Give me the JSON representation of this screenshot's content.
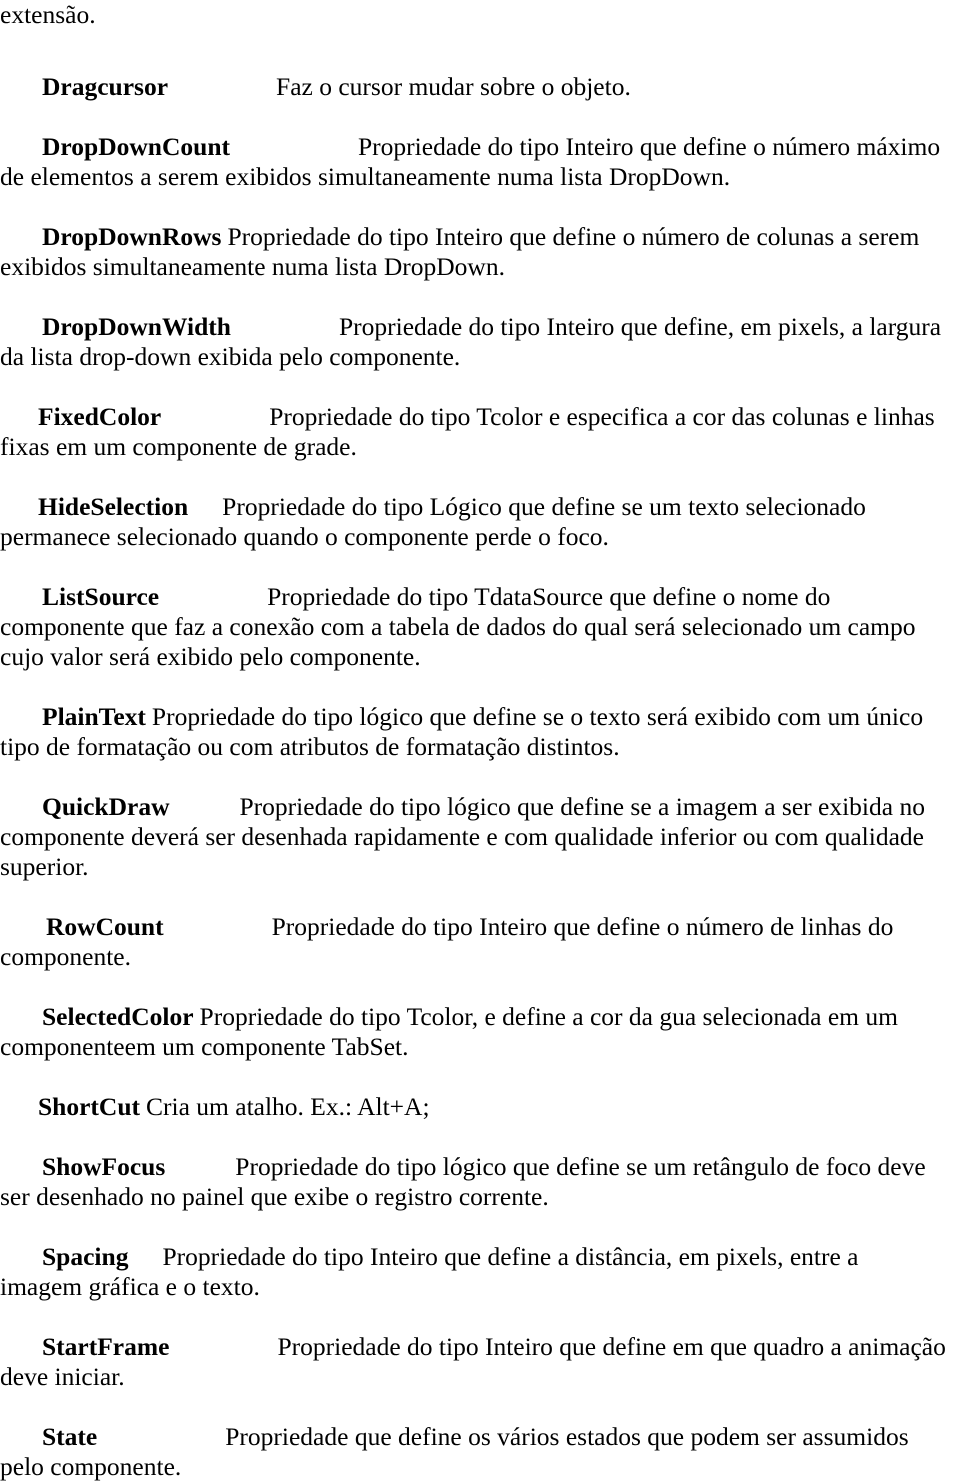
{
  "document": {
    "language": "pt-BR",
    "type": "reference-list",
    "page_background": "#ffffff",
    "text_color": "#000000",
    "continuation_line": "extensão.",
    "entries": [
      {
        "term": "Dragcursor",
        "description": "Faz o cursor mudar sobre o objeto."
      },
      {
        "term": "DropDownCount",
        "description": "Propriedade do tipo Inteiro que define o número máximo de elementos a serem exibidos simultaneamente numa lista DropDown."
      },
      {
        "term": "DropDownRows",
        "description": "Propriedade do tipo Inteiro que define o número de colunas a serem exibidos simultaneamente numa lista DropDown."
      },
      {
        "term": "DropDownWidth",
        "description": "Propriedade do tipo Inteiro que define, em pixels, a largura da lista drop-down exibida pelo componente."
      },
      {
        "term": "FixedColor",
        "description": "Propriedade do tipo Tcolor e especifica a cor das colunas e linhas fixas em um componente de grade."
      },
      {
        "term": "HideSelection",
        "description": "Propriedade do tipo Lógico que define se um texto selecionado permanece selecionado quando o componente perde o foco."
      },
      {
        "term": "ListSource",
        "description": "Propriedade do tipo TdataSource que define o nome do componente que faz a conexão com a tabela de dados do qual será selecionado um campo cujo valor será exibido pelo componente."
      },
      {
        "term": "PlainText",
        "description": "Propriedade do tipo lógico que define se o texto será exibido com um único tipo de formatação ou com atributos de formatação distintos."
      },
      {
        "term": "QuickDraw",
        "description": "Propriedade do tipo lógico que define se a imagem a ser exibida no componente deverá ser desenhada rapidamente e com qualidade inferior ou com qualidade superior."
      },
      {
        "term": "RowCount",
        "description": "Propriedade do tipo Inteiro que define o número de linhas do componente."
      },
      {
        "term": "SelectedColor",
        "description": "Propriedade do tipo Tcolor, e define a cor da gua selecionada em um componenteem um componente TabSet."
      },
      {
        "term": "ShortCut",
        "description": "Cria um atalho. Ex.: Alt+A;"
      },
      {
        "term": "ShowFocus",
        "description": "Propriedade do tipo lógico que define se um retângulo de foco deve ser desenhado no painel que exibe o registro corrente."
      },
      {
        "term": "Spacing",
        "description": "Propriedade do tipo Inteiro que define a distância, em pixels, entre a imagem gráfica e o texto."
      },
      {
        "term": "StartFrame",
        "description": "Propriedade do tipo Inteiro que define em que quadro a animação deve iniciar."
      },
      {
        "term": "State",
        "description": "Propriedade que define os vários estados que podem ser assumidos pelo componente."
      }
    ]
  }
}
